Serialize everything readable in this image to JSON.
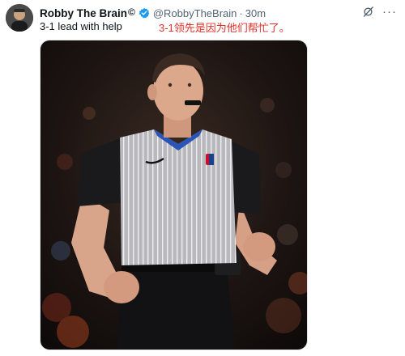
{
  "tweet": {
    "author_name": "Robby The Brain",
    "author_symbol": "©",
    "handle": "@RobbyTheBrain",
    "separator": "·",
    "time": "30m",
    "text": "3-1 lead with help",
    "annotation": "3-1领先是因为他们帮忙了。",
    "more_label": "···",
    "icons": {
      "avatar": "avatar",
      "verified": "verified-badge-icon",
      "grok": "grok-icon",
      "more": "more-options-icon"
    },
    "colors": {
      "verified": "#1d9bf0",
      "annotation": "#e0302a",
      "muted": "#536471"
    }
  }
}
